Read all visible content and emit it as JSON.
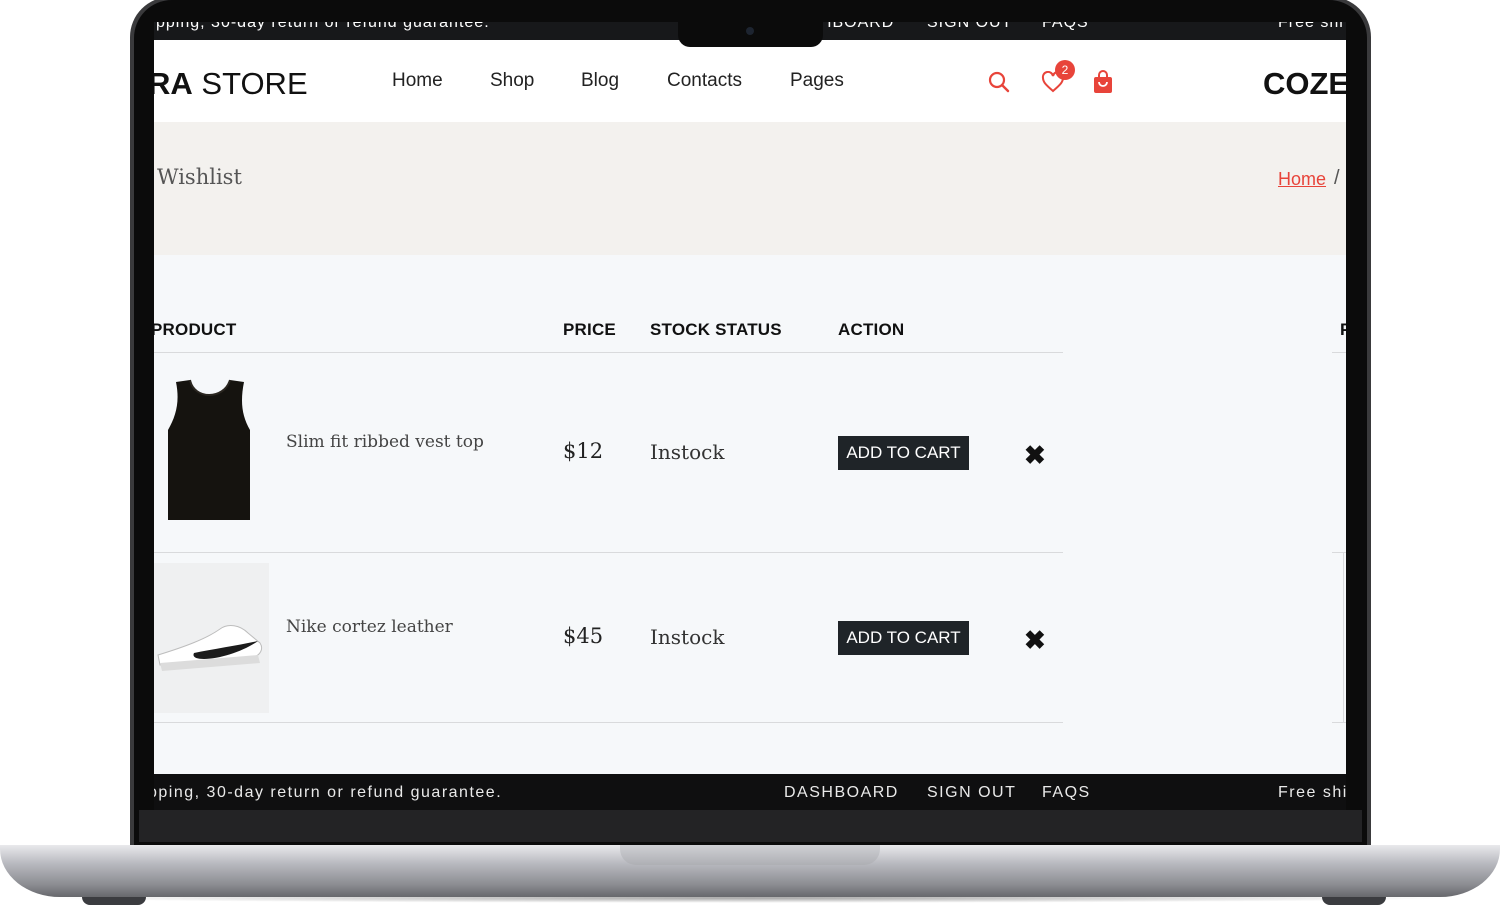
{
  "topbar": {
    "left_text": "pping, 30-day return or refund guarantee.",
    "links": [
      "DASHBOARD",
      "SIGN OUT",
      "FAQS"
    ],
    "right_text": "Free shi"
  },
  "header": {
    "logo_bold": "RA",
    "logo_rest": " STORE",
    "nav": [
      "Home",
      "Shop",
      "Blog",
      "Contacts",
      "Pages"
    ],
    "wishlist_count": "2",
    "brand_right": "COZE"
  },
  "banner": {
    "title": "Wishlist",
    "breadcrumb_home": "Home",
    "breadcrumb_sep": "/"
  },
  "table": {
    "headers": {
      "product": "PRODUCT",
      "price": "PRICE",
      "stock": "STOCK STATUS",
      "action": "ACTION",
      "partial": "P"
    },
    "rows": [
      {
        "name": "Slim fit ribbed vest top",
        "price": "$12",
        "stock": "Instock",
        "button": "ADD TO CART",
        "remove": "✖"
      },
      {
        "name": "Nike cortez leather",
        "price": "$45",
        "stock": "Instock",
        "button": "ADD TO CART",
        "remove": "✖"
      }
    ]
  },
  "footer_bar": {
    "left_text": "pping, 30-day return or refund guarantee.",
    "links": [
      "DASHBOARD",
      "SIGN OUT",
      "FAQS"
    ],
    "right_text": "Free shir"
  },
  "colors": {
    "accent": "#e8443a",
    "dark": "#1f2428",
    "banner_bg": "#f3f1ee"
  }
}
